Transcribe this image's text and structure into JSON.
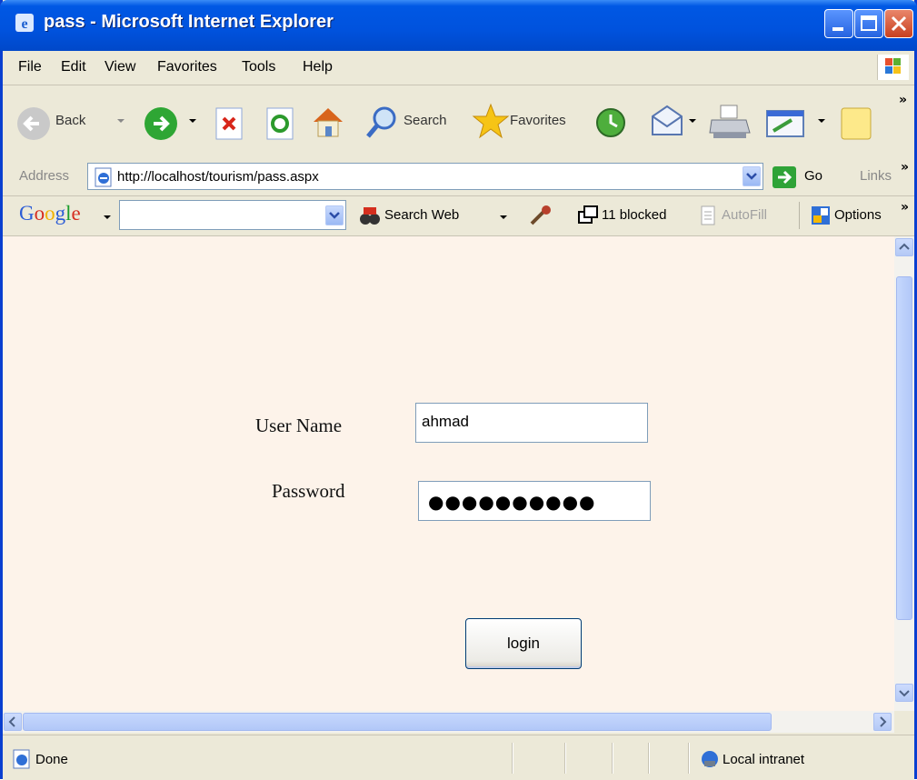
{
  "window": {
    "title": "pass - Microsoft Internet Explorer"
  },
  "menu": {
    "items": [
      "File",
      "Edit",
      "View",
      "Favorites",
      "Tools",
      "Help"
    ]
  },
  "toolbar": {
    "back_label": "Back",
    "search_label": "Search",
    "favorites_label": "Favorites"
  },
  "address": {
    "label": "Address",
    "url": "http://localhost/tourism/pass.aspx",
    "go_label": "Go",
    "links_label": "Links"
  },
  "google_bar": {
    "logo": "Google",
    "search_value": "",
    "search_web_label": "Search Web",
    "blocked_label": "11 blocked",
    "autofill_label": "AutoFill",
    "options_label": "Options"
  },
  "form": {
    "username_label": "User Name",
    "username_value": "ahmad",
    "password_label": "Password",
    "password_mask": "●●●●●●●●●●",
    "login_label": "login"
  },
  "status": {
    "text": "Done",
    "zone": "Local intranet"
  },
  "colors": {
    "titlebar": "#0052dd",
    "content_bg": "#fdf3ea",
    "chrome": "#ece9d8"
  }
}
